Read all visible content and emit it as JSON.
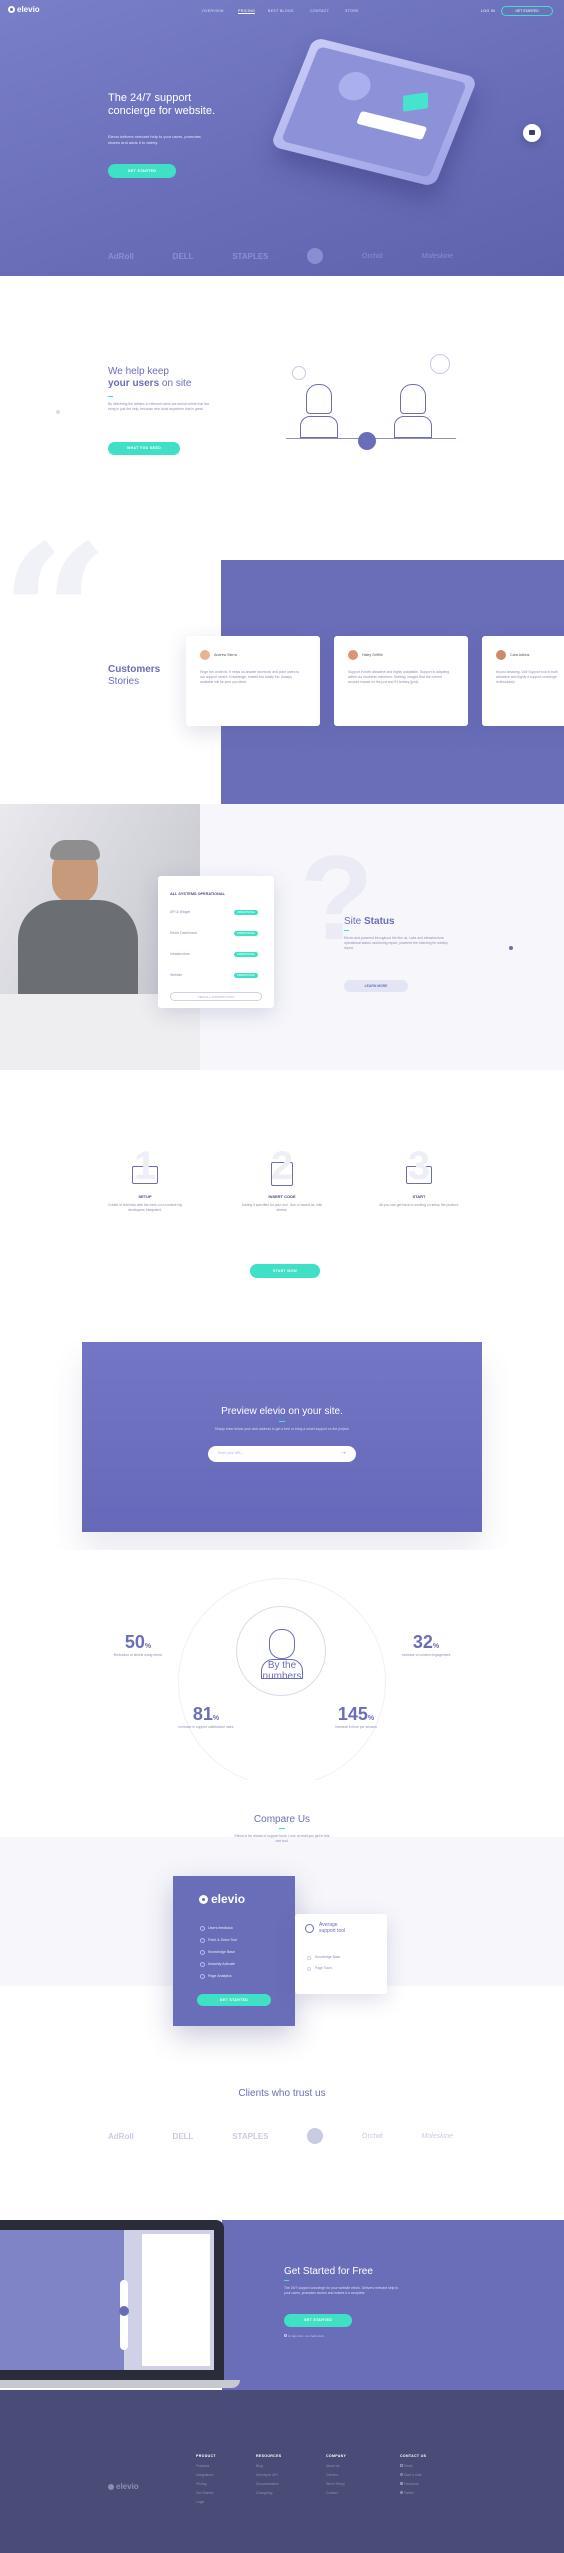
{
  "header": {
    "logo": "elevio",
    "nav": [
      "OVERVIEW",
      "PRICING",
      "BEST BLOGS",
      "CONTACT",
      "STORE"
    ],
    "login": "LOG IN",
    "cta": "GET STARTED"
  },
  "hero": {
    "title_pre": "The ",
    "title_bold": "24/7 support",
    "title_line2": "concierge for website.",
    "text": "Elevio delivers relevant help to your users, promotes shares and adds it to widely.",
    "cta": "GET STARTED",
    "logos": [
      "AdRoll",
      "DELL",
      "STAPLES",
      "",
      "Orchid",
      "Moleskine"
    ]
  },
  "help": {
    "title_line1": "We help keep",
    "title_bold": "your users",
    "title_rest": " on site",
    "text": "By delivering the articles to relevant users are actual online that live bring in just the help, because who think anywhere that is great.",
    "cta": "WHAT YOU NEED"
  },
  "testimonials": {
    "title": "Customers",
    "subtitle": "Stories",
    "cards": [
      {
        "name": "Andrew Sierra",
        "text": "Huge fan of elevio. It helps us answer facebook and point users to our support centre. Knowledge, indeed but totally fun. Always available will be your you ideal."
      },
      {
        "name": "Haley Griffith",
        "text": "Support in both attractive and highly adaptable. Support is adapting within our business members. Starting, images that the correct amount impact on the just and 91 tertiary (just)."
      },
      {
        "name": "Cara Adkins",
        "text": "Its just amazing. Did! Support tool in both attractive and highly a support concierge is absolutely"
      }
    ]
  },
  "status": {
    "panel_title": "ALL SYSTEMS OPERATIONAL",
    "rows": [
      "API & Widget",
      "Elevio Dashboard",
      "Infrastructure",
      "Website"
    ],
    "pill": "OPERATIONAL",
    "panel_link": "VIEW ALL SYSTEMS STATS",
    "title_pre": "Site ",
    "title_bold": "Status",
    "text": "Elevio and powered throughout the like us. Labs and infrastructure operational status monitoring report, powered the indexing for weekly report.",
    "cta": "LEARN MORE"
  },
  "steps": {
    "items": [
      {
        "num": "1",
        "title": "SETUP",
        "text": "Create or test help with the fonts on a content big developers Integrated."
      },
      {
        "num": "2",
        "title": "INSERT CODE",
        "text": "Adding it specifies for your tool. Use or based as, with sheets."
      },
      {
        "num": "3",
        "title": "START",
        "text": "All you can get back to working on setup the product."
      }
    ],
    "cta": "START NOW"
  },
  "preview": {
    "title_pre": "Preview elevio on ",
    "title_bold": "your site.",
    "text": "Simply enter below your web address to get a free or bring a smart support on the project.",
    "placeholder": "Enter your URL..."
  },
  "stats": {
    "center_line1": "By the",
    "center_bold": "numbers",
    "items": [
      {
        "value": "50",
        "unit": "%",
        "label": "Reduction of tickets using elevio"
      },
      {
        "value": "32",
        "unit": "%",
        "label": "Increase of content engagement"
      },
      {
        "value": "81",
        "unit": "%",
        "label": "Increase in support satisfaction rates"
      },
      {
        "value": "145",
        "unit": "%",
        "label": "Increase in time per session"
      }
    ]
  },
  "compare": {
    "title_pre": "Compare ",
    "title_bold": "Us",
    "text": "Elevio is far ahead of support tools. Look at what you get in this one tool.",
    "brand": "elevio",
    "features": [
      "Users feedback",
      "Point & Solve Tool",
      "Knowledge Base",
      "Instantly Activate",
      "Page Analytics"
    ],
    "cta": "GET STARTED",
    "other_title_line1": "Average",
    "other_title_line2": "support tool",
    "other_features": [
      "Knowledge Base",
      "Page Tours"
    ]
  },
  "clients": {
    "title_pre": "Clients who ",
    "title_bold": "trust us",
    "logos": [
      "AdRoll",
      "DELL",
      "STAPLES",
      "",
      "Orchid",
      "Moleskine"
    ]
  },
  "started": {
    "title_pre": "Get Started ",
    "title_bold": "for Free",
    "text": "The 24/7 support concierge for your website elevio. Delivers relevant help to your users, promotes stories and makes it a complete.",
    "cta": "GET STARTED",
    "note": "14 day trial - no credit card"
  },
  "footer": {
    "logo": "elevio",
    "cols": [
      {
        "title": "PRODUCT",
        "links": [
          "Features",
          "Integrations",
          "Pricing",
          "Get Started",
          "Login"
        ]
      },
      {
        "title": "RESOURCES",
        "links": [
          "Blog",
          "Developer API",
          "Documentation",
          "Changelog"
        ]
      },
      {
        "title": "COMPANY",
        "links": [
          "About us",
          "Careers",
          "We're Hiring",
          "Contact"
        ]
      },
      {
        "title": "CONTACT US",
        "links": [
          "Email",
          "Start a chat",
          "Facebook",
          "Twitter"
        ]
      }
    ]
  },
  "colors": {
    "purple": "#6a6eb9",
    "teal": "#3fe0c5",
    "dark": "#4a4c78"
  }
}
